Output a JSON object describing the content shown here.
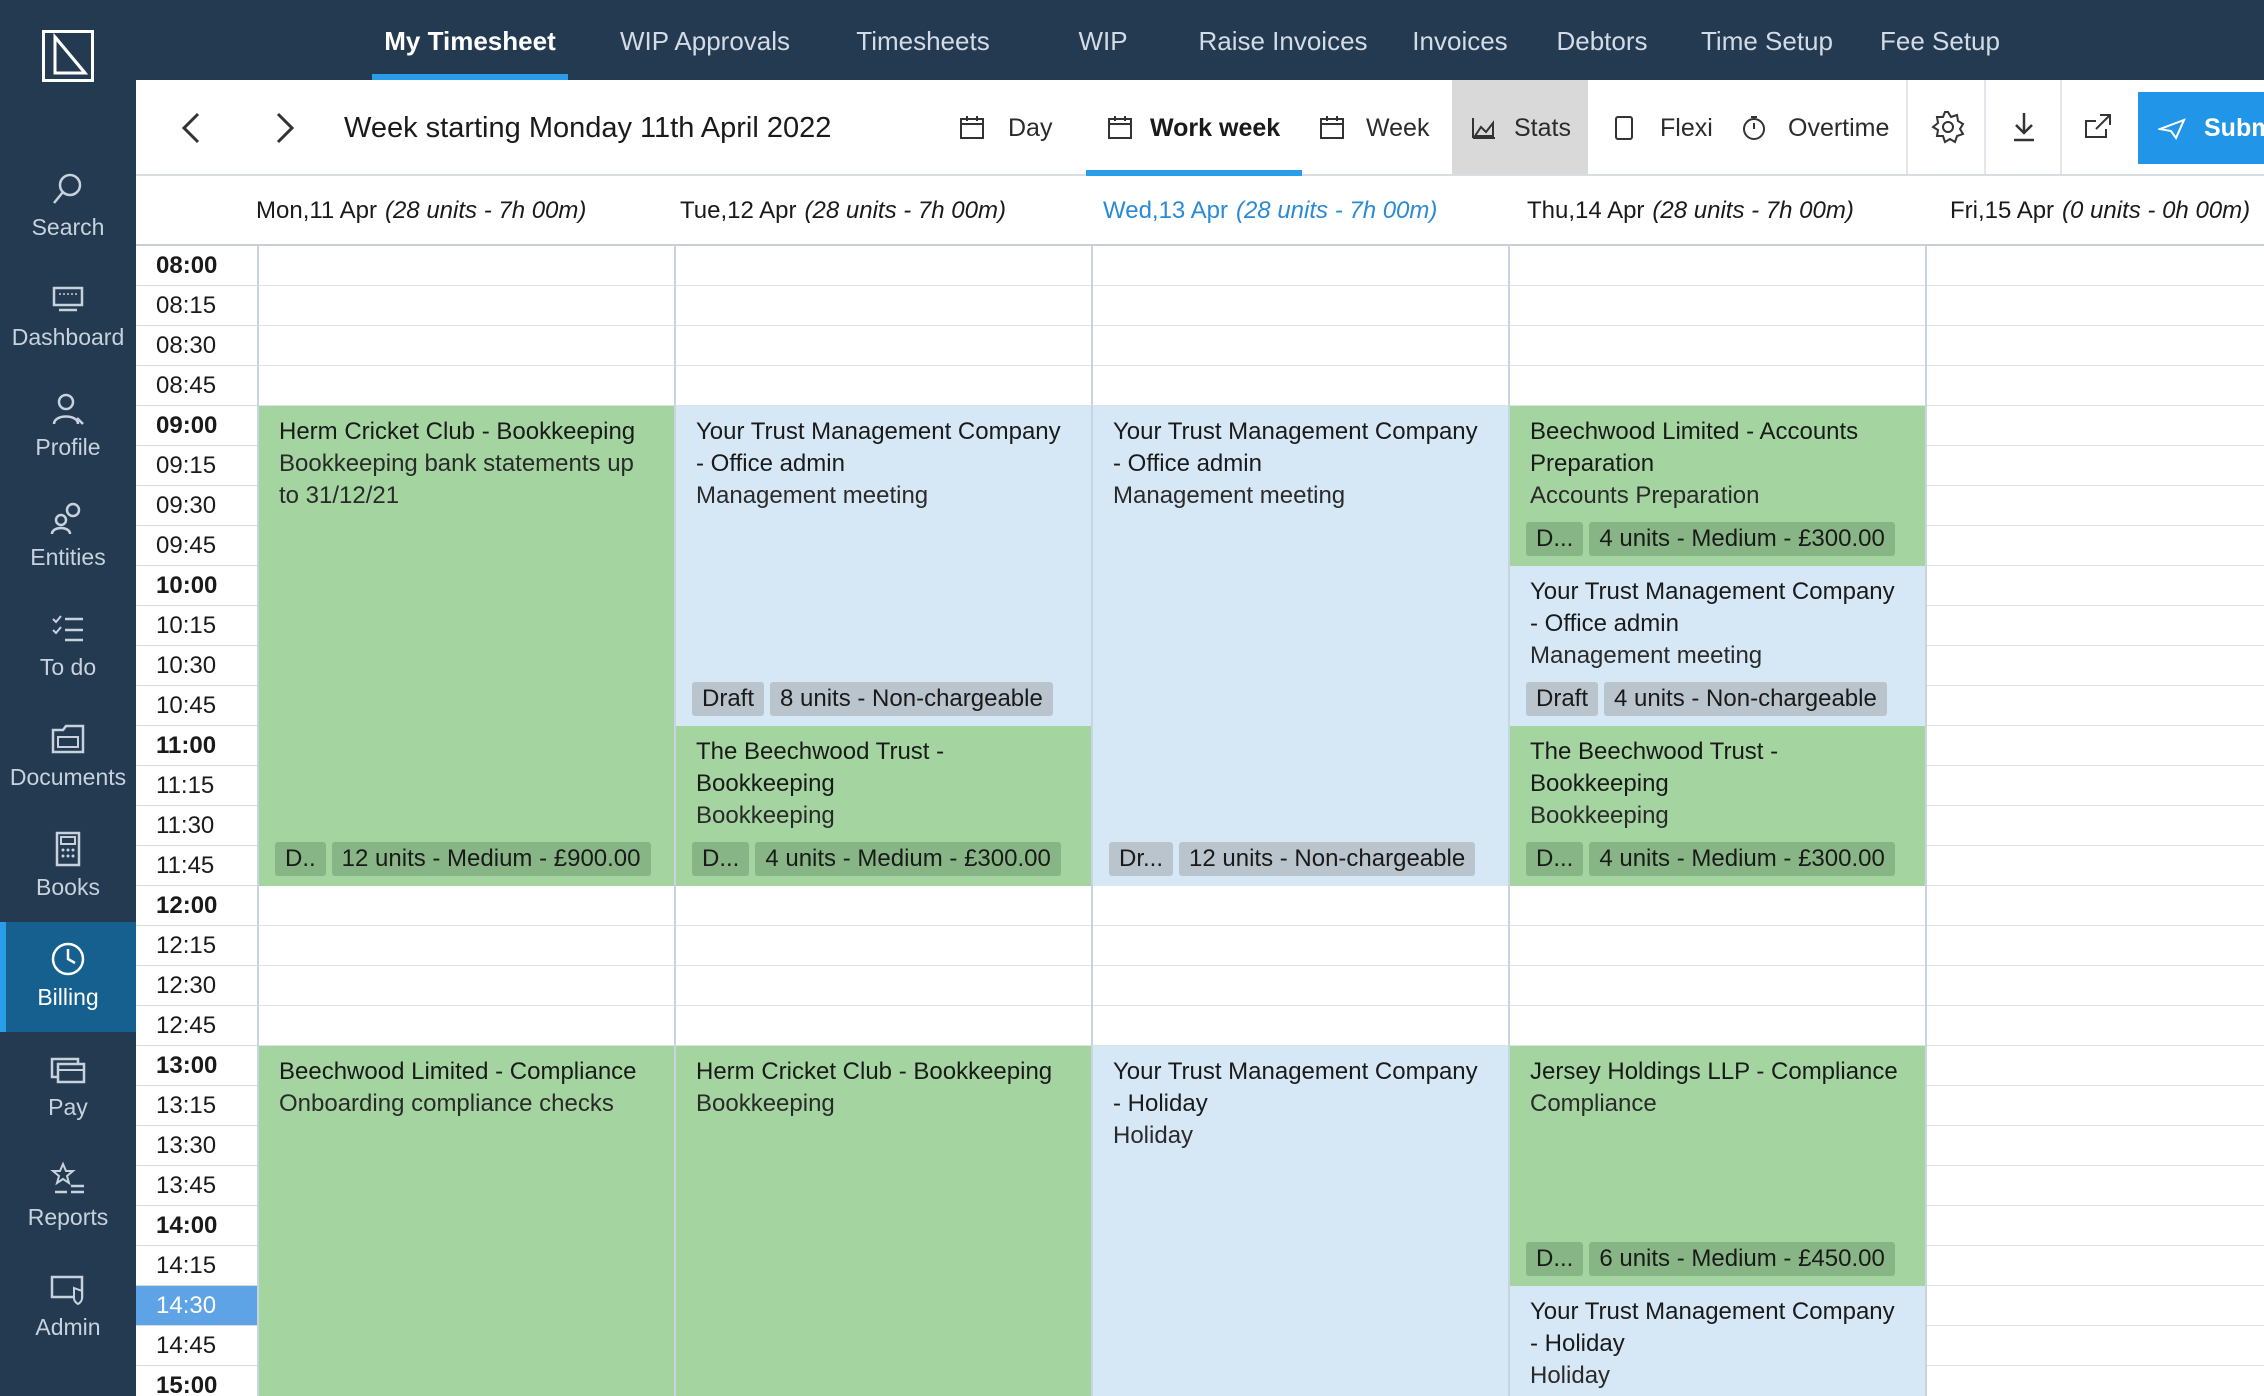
{
  "sidebar": {
    "items": [
      {
        "label": "Search",
        "icon": "search-icon"
      },
      {
        "label": "Dashboard",
        "icon": "monitor-icon"
      },
      {
        "label": "Profile",
        "icon": "user-icon"
      },
      {
        "label": "Entities",
        "icon": "users-icon"
      },
      {
        "label": "To do",
        "icon": "checklist-icon"
      },
      {
        "label": "Documents",
        "icon": "folder-icon"
      },
      {
        "label": "Books",
        "icon": "calculator-icon"
      },
      {
        "label": "Billing",
        "icon": "clock-icon"
      },
      {
        "label": "Pay",
        "icon": "card-icon"
      },
      {
        "label": "Reports",
        "icon": "star-list-icon"
      },
      {
        "label": "Admin",
        "icon": "shield-icon"
      }
    ],
    "active": "Billing"
  },
  "nav": {
    "tabs": [
      "My Timesheet",
      "WIP Approvals",
      "Timesheets",
      "WIP",
      "Raise Invoices",
      "Invoices",
      "Debtors",
      "Time Setup",
      "Fee Setup"
    ],
    "active": "My Timesheet"
  },
  "toolbar": {
    "title": "Week starting Monday 11th April 2022",
    "views": {
      "day": "Day",
      "work_week": "Work week",
      "week": "Week"
    },
    "stats": "Stats",
    "flexi": "Flexi",
    "overtime": "Overtime",
    "submit": "Subm"
  },
  "days": [
    {
      "name": "Mon,11 Apr",
      "summary": "(28 units - 7h 00m)"
    },
    {
      "name": "Tue,12 Apr",
      "summary": "(28 units - 7h 00m)"
    },
    {
      "name": "Wed,13 Apr",
      "summary": "(28 units - 7h 00m)",
      "today": true
    },
    {
      "name": "Thu,14 Apr",
      "summary": "(28 units - 7h 00m)"
    },
    {
      "name": "Fri,15 Apr",
      "summary": "(0 units - 0h 00m)"
    }
  ],
  "times": [
    "08:00",
    "08:15",
    "08:30",
    "08:45",
    "09:00",
    "09:15",
    "09:30",
    "09:45",
    "10:00",
    "10:15",
    "10:30",
    "10:45",
    "11:00",
    "11:15",
    "11:30",
    "11:45",
    "12:00",
    "12:15",
    "12:30",
    "12:45",
    "13:00",
    "13:15",
    "13:30",
    "13:45",
    "14:00",
    "14:15",
    "14:30",
    "14:45",
    "15:00"
  ],
  "current_time": "14:30",
  "events": [
    {
      "day": 0,
      "start": 4,
      "end": 16,
      "color": "green",
      "title": "Herm Cricket Club - Bookkeeping",
      "desc": "Bookkeeping bank statements up to 31/12/21",
      "tags": [
        "D..",
        "12 units - Medium - £900.00"
      ]
    },
    {
      "day": 1,
      "start": 4,
      "end": 12,
      "color": "blue",
      "title": "Your Trust Management Company - Office admin",
      "desc": "Management meeting",
      "tags": [
        "Draft",
        "8 units - Non-chargeable"
      ]
    },
    {
      "day": 1,
      "start": 12,
      "end": 16,
      "color": "green",
      "title": "The Beechwood Trust - Bookkeeping",
      "desc": "Bookkeeping",
      "tags": [
        "D...",
        "4 units - Medium - £300.00"
      ]
    },
    {
      "day": 2,
      "start": 4,
      "end": 16,
      "color": "blue",
      "title": "Your Trust Management Company - Office admin",
      "desc": "Management meeting",
      "tags": [
        "Dr...",
        "12 units - Non-chargeable"
      ]
    },
    {
      "day": 3,
      "start": 4,
      "end": 8,
      "color": "green",
      "title": "Beechwood Limited - Accounts Preparation",
      "desc": "Accounts Preparation",
      "tags": [
        "D...",
        "4 units - Medium - £300.00"
      ]
    },
    {
      "day": 3,
      "start": 8,
      "end": 12,
      "color": "blue",
      "title": "Your Trust Management Company - Office admin",
      "desc": "Management meeting",
      "tags": [
        "Draft",
        "4 units - Non-chargeable"
      ]
    },
    {
      "day": 3,
      "start": 12,
      "end": 16,
      "color": "green",
      "title": "The Beechwood Trust - Bookkeeping",
      "desc": "Bookkeeping",
      "tags": [
        "D...",
        "4 units - Medium - £300.00"
      ]
    },
    {
      "day": 0,
      "start": 20,
      "end": 30,
      "color": "green",
      "title": "Beechwood Limited - Compliance",
      "desc": "Onboarding compliance checks",
      "tags": []
    },
    {
      "day": 1,
      "start": 20,
      "end": 30,
      "color": "green",
      "title": "Herm Cricket Club - Bookkeeping",
      "desc": "Bookkeeping",
      "tags": []
    },
    {
      "day": 2,
      "start": 20,
      "end": 30,
      "color": "blue",
      "title": "Your Trust Management Company - Holiday",
      "desc": "Holiday",
      "tags": []
    },
    {
      "day": 3,
      "start": 20,
      "end": 26,
      "color": "green",
      "title": "Jersey Holdings LLP - Compliance",
      "desc": "Compliance",
      "tags": [
        "D...",
        "6 units - Medium - £450.00"
      ]
    },
    {
      "day": 3,
      "start": 26,
      "end": 30,
      "color": "blue",
      "title": "Your Trust Management Company - Holiday",
      "desc": "Holiday",
      "tags": []
    }
  ]
}
